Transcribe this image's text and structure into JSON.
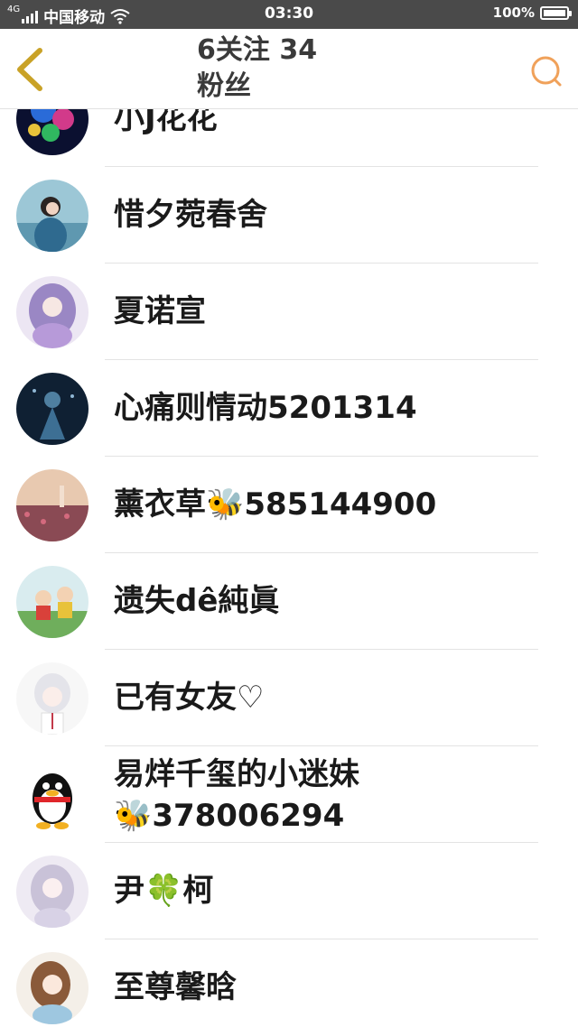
{
  "status_bar": {
    "network": "4G",
    "carrier": "中国移动",
    "time": "03:30",
    "battery_percent": "100%",
    "battery_level": 1.0
  },
  "header": {
    "title": "6关注   34\n粉丝",
    "back_icon": "chevron-left-icon",
    "search_icon": "search-icon",
    "accent_color": "#f0a15a",
    "back_color": "#c9a227"
  },
  "followers": [
    {
      "name": "小J花花",
      "avatar": "colorful-abstract"
    },
    {
      "name": "惜夕菀春舍",
      "avatar": "girl-seaside"
    },
    {
      "name": "夏诺宣",
      "avatar": "anime-girl-purple"
    },
    {
      "name": "心痛则情动5201314",
      "avatar": "dark-blue-figure"
    },
    {
      "name": "薰衣草🐝585144900",
      "avatar": "flower-field"
    },
    {
      "name": "遗失dê純眞",
      "avatar": "cartoon-kids"
    },
    {
      "name": "已有女友♡",
      "avatar": "anime-boy-white"
    },
    {
      "name": "易烊千玺的小迷妹\n🐝378006294",
      "avatar": "qq-penguin"
    },
    {
      "name": "尹🍀柯",
      "avatar": "anime-girl-pale"
    },
    {
      "name": "至尊馨晗",
      "avatar": "anime-girl-brown"
    }
  ]
}
